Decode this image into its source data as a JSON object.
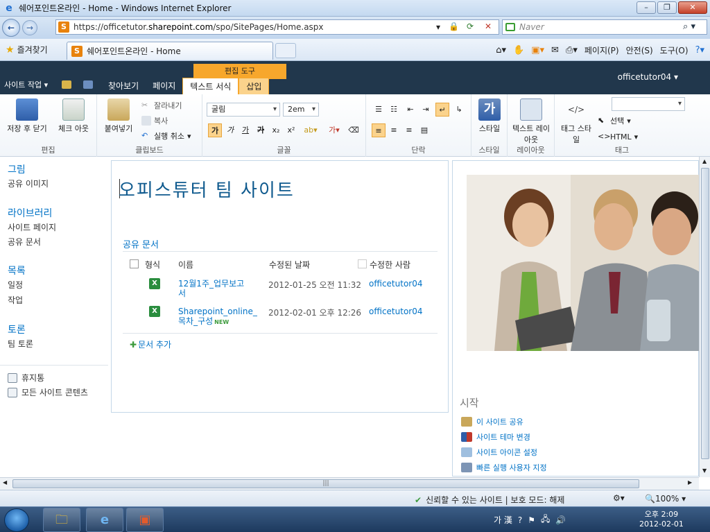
{
  "window": {
    "title": "쉐어포인트온라인 - Home - Windows Internet Explorer"
  },
  "address": {
    "url_prefix": "https://officetutor.",
    "url_domain": "sharepoint.com",
    "url_path": "/spo/SitePages/Home.aspx",
    "search_placeholder": "Naver"
  },
  "favorites": {
    "label": "즐겨찾기",
    "tab_title": "쉐어포인트온라인 - Home"
  },
  "commandbar": {
    "page": "페이지(P)",
    "safety": "안전(S)",
    "tools": "도구(O)"
  },
  "sharepoint": {
    "site_actions": "사이트 작업",
    "contextual_group": "편집 도구",
    "tabs": [
      "찾아보기",
      "페이지",
      "텍스트 서식",
      "삽입"
    ],
    "user": "officetutor04"
  },
  "ribbon": {
    "edit": {
      "save": "저장 후 닫기",
      "checkout": "체크 아웃",
      "label": "편집"
    },
    "clipboard": {
      "paste": "붙여넣기",
      "cut": "잘라내기",
      "copy": "복사",
      "undo": "실행 취소",
      "label": "클립보드"
    },
    "font": {
      "family": "굴림",
      "size": "2em",
      "label": "글꼴"
    },
    "paragraph": {
      "label": "단락"
    },
    "styles": {
      "button": "스타일",
      "label": "스타일"
    },
    "layout": {
      "button": "텍스트 레이아웃",
      "label": "레이아웃"
    },
    "markup": {
      "tag_style": "태그 스타일",
      "select": "선택",
      "html": "HTML",
      "label": "태그"
    }
  },
  "leftnav": {
    "sections": [
      {
        "heading": "그림",
        "items": [
          "공유 이미지"
        ]
      },
      {
        "heading": "라이브러리",
        "items": [
          "사이트 페이지",
          "공유 문서"
        ]
      },
      {
        "heading": "목록",
        "items": [
          "일정",
          "작업"
        ]
      },
      {
        "heading": "토론",
        "items": [
          "팀 토론"
        ]
      }
    ],
    "recycle": "휴지통",
    "all_content": "모든 사이트 콘텐츠"
  },
  "main": {
    "title": "오피스튜터 팀 사이트",
    "library_title": "공유 문서",
    "columns": [
      "형식",
      "이름",
      "수정된 날짜",
      "수정한 사람"
    ],
    "rows": [
      {
        "name_line1": "12월1주_업무보고",
        "name_line2": "서",
        "modified": "2012-01-25 오전 11:32",
        "by": "officetutor04"
      },
      {
        "name_line1": "Sharepoint_online_",
        "name_line2": "목차_구성",
        "modified": "2012-02-01 오후 12:26",
        "by": "officetutor04",
        "badge": "NEW"
      }
    ],
    "add_doc": "문서 추가"
  },
  "getting_started": {
    "title": "시작",
    "links": [
      "이 사이트 공유",
      "사이트 테마 변경",
      "사이트 아이콘 설정",
      "빠른 실행 사용자 지정"
    ]
  },
  "statusbar": {
    "zone": "신뢰할 수 있는 사이트 | 보호 모드: 해제",
    "zoom": "100%"
  },
  "taskbar": {
    "ime": "가 漢",
    "time": "오후 2:09",
    "date": "2012-02-01"
  },
  "colors": {
    "accent": "#0072c6",
    "ribbon_dark": "#21374c",
    "contextual": "#f7a72c"
  }
}
